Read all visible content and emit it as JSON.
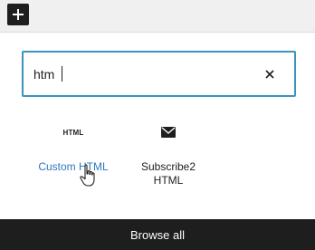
{
  "toolbar": {
    "add_icon": "plus-icon"
  },
  "search": {
    "value": "htm",
    "clear_icon": "close-icon"
  },
  "results": [
    {
      "label": "Custom HTML",
      "icon": "html-icon",
      "icon_text": "HTML",
      "state": "hovered"
    },
    {
      "label": "Subscribe2 HTML",
      "icon": "envelope-icon"
    }
  ],
  "footer": {
    "browse_all_label": "Browse all"
  },
  "colors": {
    "dark": "#1e1e1e",
    "focus_border": "#3a95bd",
    "hover_link": "#2d77bd",
    "background": "#f0f0f1"
  }
}
